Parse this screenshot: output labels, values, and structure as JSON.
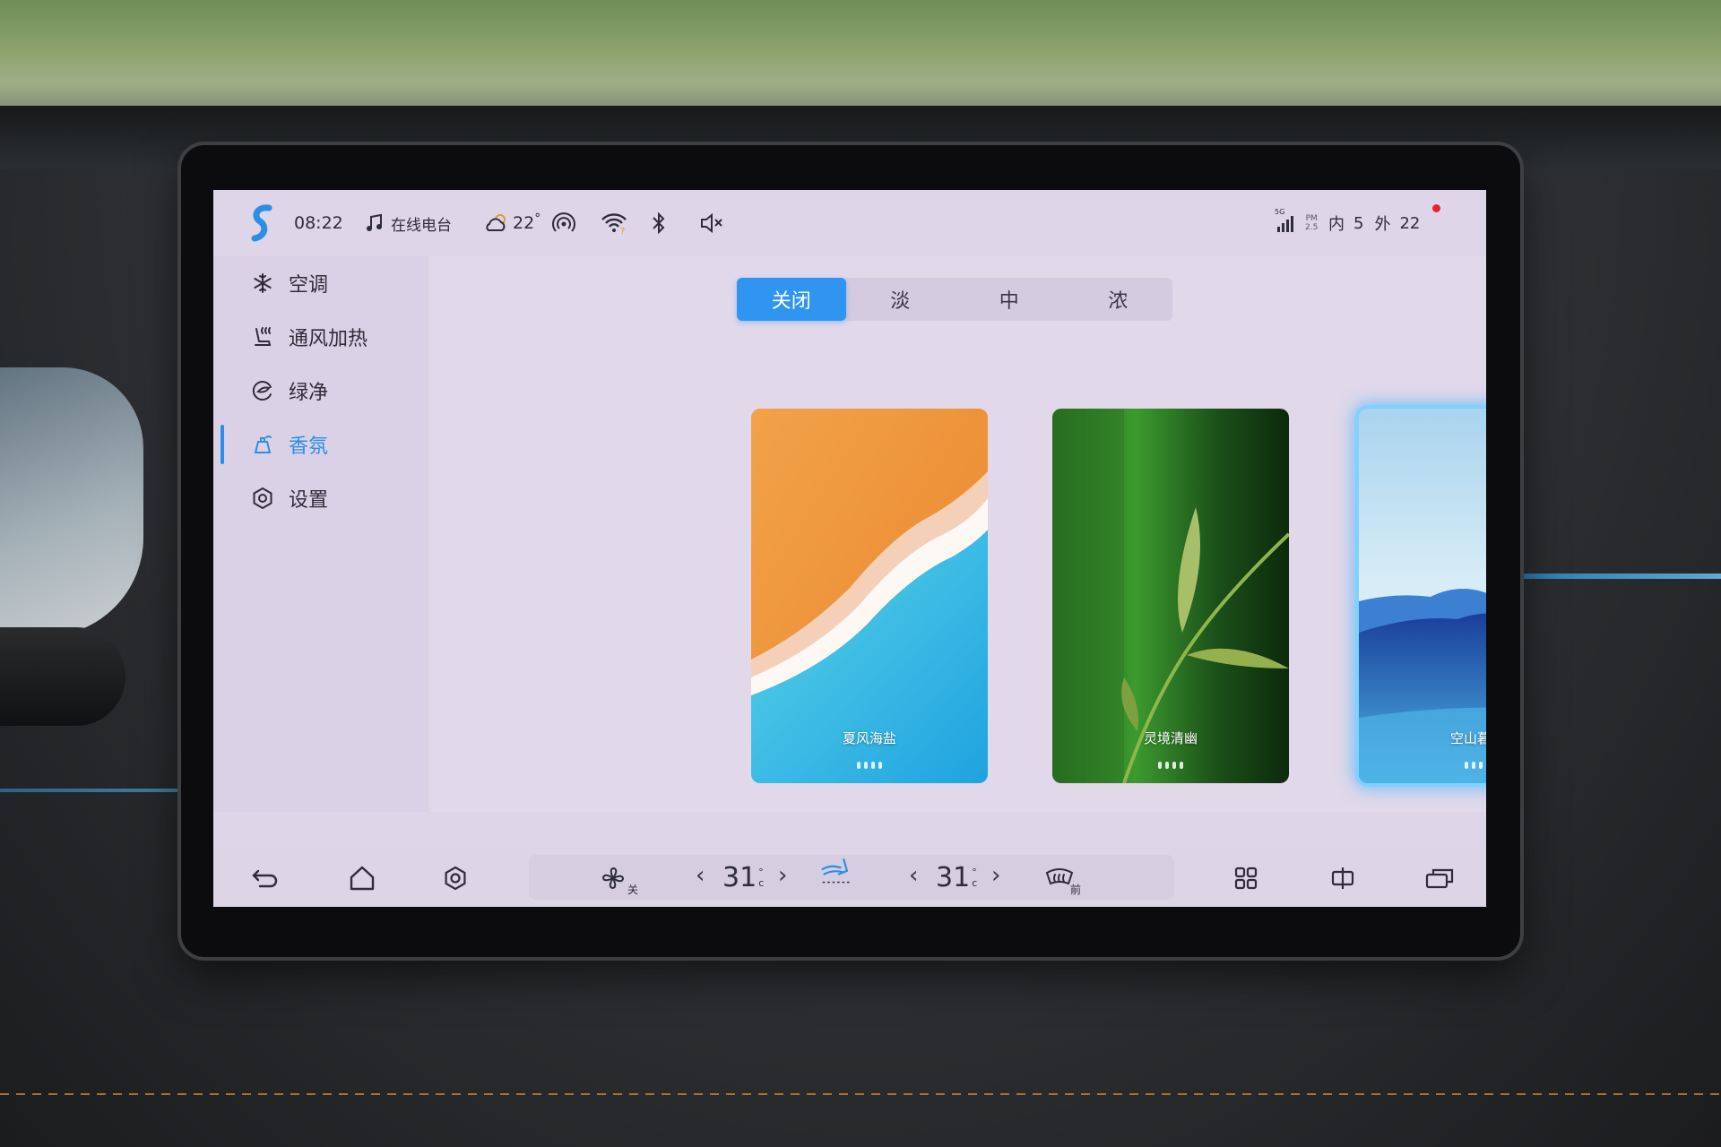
{
  "status_bar": {
    "time": "08:22",
    "music_label": "在线电台",
    "temperature": "22",
    "temperature_unit": "°",
    "signal": "5G",
    "pm_label": "PM",
    "pm_sub": "2.5",
    "pm_inside_label": "内",
    "pm_inside_value": "5",
    "pm_outside_label": "外",
    "pm_outside_value": "22"
  },
  "sidebar": {
    "items": [
      {
        "label": "空调",
        "icon": "snowflake-icon"
      },
      {
        "label": "通风加热",
        "icon": "seat-heat-icon"
      },
      {
        "label": "绿净",
        "icon": "purify-icon"
      },
      {
        "label": "香氛",
        "icon": "fragrance-icon",
        "active": true
      },
      {
        "label": "设置",
        "icon": "settings-icon"
      }
    ]
  },
  "intensity": {
    "options": [
      "关闭",
      "淡",
      "中",
      "浓"
    ],
    "selected": "关闭"
  },
  "scents": [
    {
      "name": "夏风海盐",
      "selected": false
    },
    {
      "name": "灵境清幽",
      "selected": false
    },
    {
      "name": "空山暮雨",
      "selected": true
    }
  ],
  "dock": {
    "fan_label": "关",
    "left_temp": "31",
    "right_temp": "31",
    "temp_unit_top": "°",
    "temp_unit_bottom": "c",
    "defrost_label": "前"
  },
  "colors": {
    "accent": "#2f95f0",
    "screen_bg": "#ded5e8",
    "selected_glow": "#7fd2ff"
  }
}
